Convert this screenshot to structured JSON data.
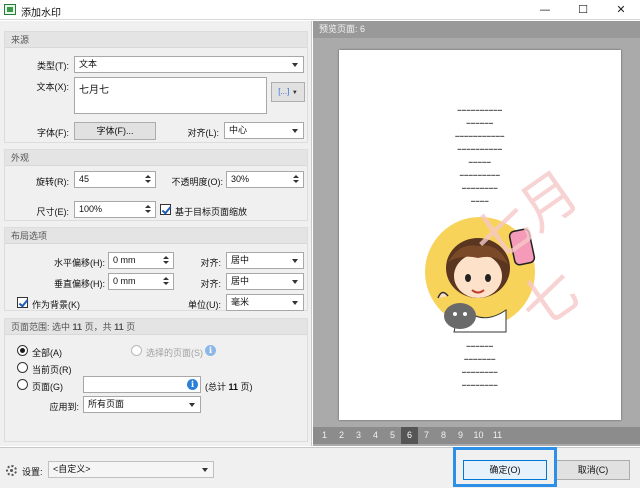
{
  "window": {
    "title": "添加水印",
    "minimize": "—",
    "maximize": "☐",
    "close": "✕"
  },
  "source": {
    "header": "来源",
    "type_label": "类型(T):",
    "type_value": "文本",
    "text_label": "文本(X):",
    "text_value": "七月七",
    "insert_button": "[...]",
    "font_label": "字体(F):",
    "font_button": "字体(F)...",
    "align_label": "对齐(L):",
    "align_value": "中心"
  },
  "appearance": {
    "header": "外观",
    "rotation_label": "旋转(R):",
    "rotation_value": "45",
    "opacity_label": "不透明度(O):",
    "opacity_value": "30%",
    "size_label": "尺寸(E):",
    "size_value": "100%",
    "scale_label": "基于目标页面缩放",
    "scale_checked": true
  },
  "layout": {
    "header": "布局选项",
    "h_offset_label": "水平偏移(H):",
    "h_offset_value": "0 mm",
    "v_offset_label": "垂直偏移(H):",
    "v_offset_value": "0 mm",
    "h_align_label": "对齐:",
    "h_align_value": "居中",
    "v_align_label": "对齐:",
    "v_align_value": "居中",
    "background_label": "作为背景(K)",
    "background_checked": true,
    "unit_label": "单位(U):",
    "unit_value": "毫米"
  },
  "range": {
    "header_pre": "页面范围: 选中",
    "selected_count": "11",
    "header_mid": "页，共",
    "total_count": "11",
    "header_post": "页",
    "all_label": "全部(A)",
    "selected_pages_label": "选择的页面(S)",
    "current_label": "当前页(R)",
    "pages_label": "页面(G)",
    "pages_value": "",
    "total_label_pre": "(总计",
    "total_label_post": "页)",
    "apply_label": "应用到:",
    "apply_value": "所有页面"
  },
  "preview": {
    "header": "预览页面: 6",
    "watermark_text": "七月七",
    "pages": [
      "1",
      "2",
      "3",
      "4",
      "5",
      "6",
      "7",
      "8",
      "9",
      "10",
      "11"
    ],
    "current_page": "6"
  },
  "bottom": {
    "settings_label": "设置:",
    "settings_value": "<自定义>",
    "ok_button": "确定(O)",
    "cancel_button": "取消(C)"
  },
  "colors": {
    "accent": "#2d8fe6",
    "watermark": "#f6c9c9",
    "info": "#2b7fd6"
  }
}
